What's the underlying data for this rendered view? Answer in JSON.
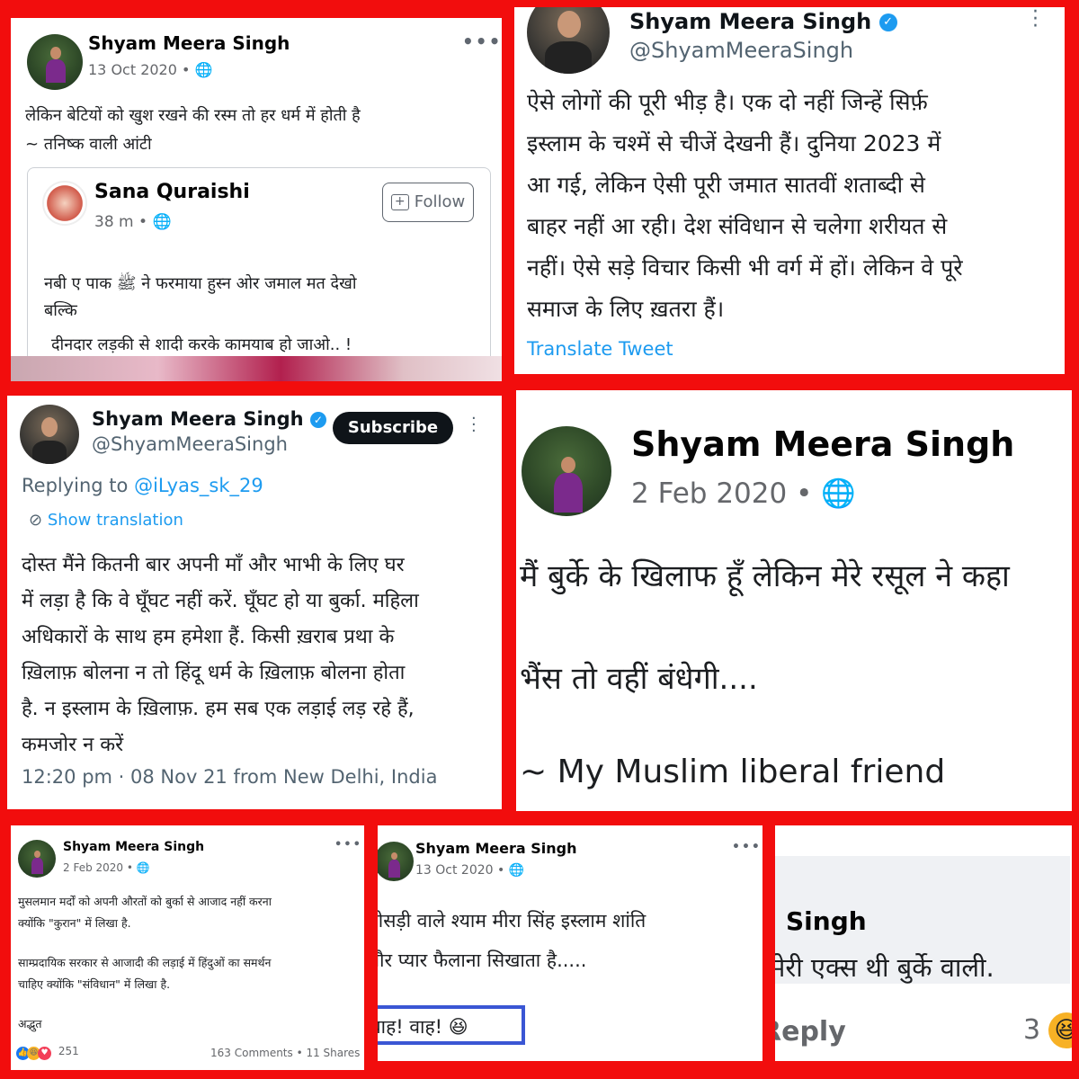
{
  "p1": {
    "name": "Shyam Meera Singh",
    "date": "13 Oct 2020 • ",
    "lines": [
      "लेकिन बेटियों को खुश रखने की रस्म तो हर धर्म में होती है",
      "~ तनिष्क वाली आंटी"
    ],
    "shared": {
      "name": "Sana Quraishi",
      "time": "38 m • ",
      "follow": "Follow",
      "lines": [
        "नबी ए पाक ﷺ ने फरमाया हुस्न ओर जमाल मत देखो",
        "बल्कि",
        "दीनदार लड़की से शादी करके कामयाब हो जाओ.. !"
      ]
    }
  },
  "p2": {
    "name": "Shyam Meera Singh",
    "handle": "@ShyamMeeraSingh",
    "lines": [
      "ऐसे लोगों की पूरी भीड़ है। एक दो नहीं जिन्हें सिर्फ़",
      "इस्लाम के चश्में से चीजें देखनी हैं। दुनिया 2023 में",
      "आ गई, लेकिन ऐसी पूरी जमात सातवीं शताब्दी से",
      "बाहर नहीं आ रही। देश संविधान से चलेगा शरीयत से",
      "नहीं। ऐसे सड़े विचार किसी भी वर्ग में हों। लेकिन वे पूरे",
      "समाज के लिए ख़तरा हैं।"
    ],
    "translate": "Translate Tweet"
  },
  "p3": {
    "name": "Shyam Meera Singh",
    "handle": "@ShyamMeeraSingh",
    "subscribe": "Subscribe",
    "replying_prefix": "Replying to ",
    "replying_to": "@iLyas_sk_29",
    "show_translation": "Show translation",
    "lines": [
      "दोस्त मैंने कितनी बार अपनी माँ और भाभी के लिए घर",
      "में लड़ा है कि वे घूँघट नहीं करें. घूँघट हो या बुर्का. महिला",
      "अधिकारों के साथ हम हमेशा हैं. किसी ख़राब प्रथा के",
      "ख़िलाफ़ बोलना न तो हिंदू धर्म के ख़िलाफ़ बोलना होता",
      "है. न इस्लाम के ख़िलाफ़. हम सब एक लड़ाई लड़ रहे हैं,",
      "कमजोर न करें"
    ],
    "footer": "12:20 pm · 08 Nov 21 from New Delhi, India"
  },
  "p4": {
    "name": "Shyam Meera Singh",
    "date": "2 Feb 2020 • ",
    "line1": "मैं बुर्के के खिलाफ हूँ लेकिन मेरे रसूल ने कहा",
    "line2": "भैंस तो वहीं बंधेगी....",
    "line3": "~ My Muslim liberal friend"
  },
  "p5": {
    "name": "Shyam Meera Singh",
    "date": "2 Feb 2020 • ",
    "lines": [
      "मुसलमान मर्दों को अपनी औरतों को बुर्का से आजाद नहीं करना",
      "क्योंकि \"कुरान\" में लिखा है.",
      "साम्प्रदायिक सरकार से आजादी की लड़ाई में हिंदुओं का समर्थन",
      "चाहिए क्योंकि \"संविधान\" में लिखा है.",
      "अद्भुत"
    ],
    "reactions": "251",
    "comments_shares": "163 Comments • 11 Shares"
  },
  "p6": {
    "name": "Shyam Meera Singh",
    "date": "13 Oct 2020 • ",
    "lines": [
      "भोसड़ी वाले श्याम मीरा सिंह इस्लाम शांति",
      "और प्यार फैलाना सिखाता है....."
    ],
    "box": "वाह! वाह! 😆"
  },
  "p7": {
    "name": "Singh",
    "line": "मेरी एक्स थी बुर्के वाली.",
    "reply": "Reply",
    "count": "3"
  },
  "colors": {
    "frame": "#f20d0d",
    "twitter_blue": "#1d9bf0",
    "box_border": "#3a56d4"
  }
}
